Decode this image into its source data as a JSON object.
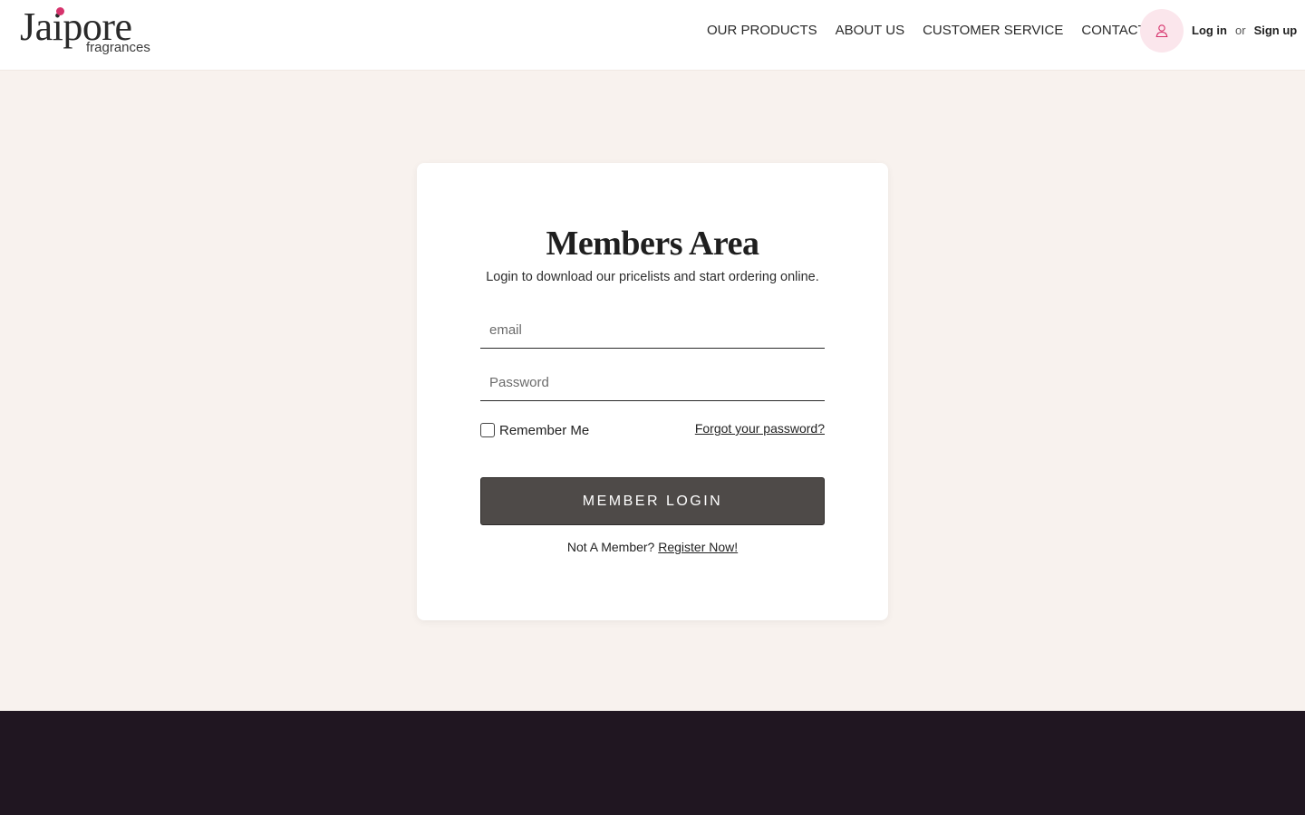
{
  "header": {
    "logo_main": "Jaipore",
    "logo_sub": "fragrances",
    "nav": [
      "OUR PRODUCTS",
      "ABOUT US",
      "CUSTOMER SERVICE",
      "CONTACT US"
    ],
    "avatar_icon": "user-icon",
    "login_label": "Log in",
    "or_label": "or",
    "signup_label": "Sign up"
  },
  "login_card": {
    "title": "Members Area",
    "subtitle": "Login to download our pricelists and start ordering online.",
    "email_placeholder": "email",
    "email_value": "",
    "password_placeholder": "Password",
    "password_value": "",
    "remember_label": "Remember Me",
    "remember_checked": false,
    "forgot_label": "Forgot your password?",
    "submit_label": "MEMBER LOGIN",
    "not_member_text": "Not A Member?",
    "register_label": "Register Now!"
  },
  "colors": {
    "page_background": "#f8f2ee",
    "header_background": "#ffffff",
    "button_background": "#4e4a48",
    "footer_background": "#201621",
    "logo_accent": "#d6336c",
    "avatar_background": "#fbe6ec"
  }
}
